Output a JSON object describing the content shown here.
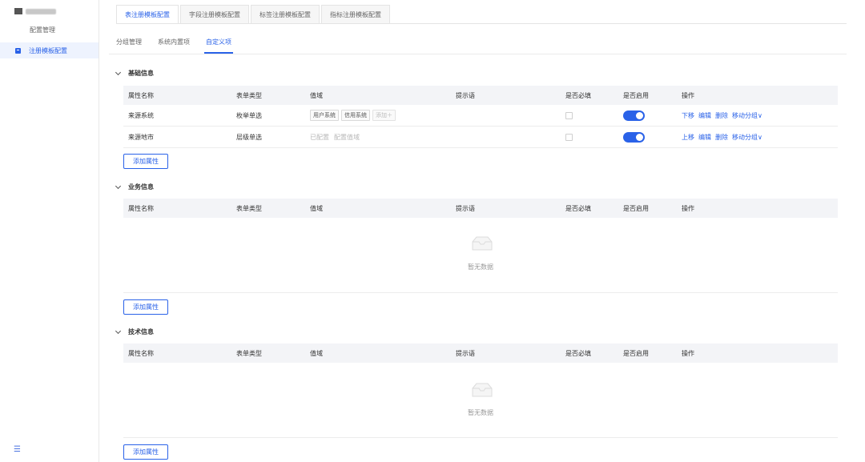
{
  "sidebar": {
    "title": "配置管理",
    "active_item": "注册模板配置"
  },
  "top_tabs": [
    "表注册模板配置",
    "字段注册模板配置",
    "标签注册模板配置",
    "指标注册模板配置"
  ],
  "sub_tabs": [
    "分组管理",
    "系统内置项",
    "自定义项"
  ],
  "columns": [
    "属性名称",
    "表单类型",
    "值域",
    "提示语",
    "是否必填",
    "是否启用",
    "操作"
  ],
  "sections": [
    {
      "title": "基础信息",
      "rows": [
        {
          "name": "来源系统",
          "type": "枚举单选",
          "domain_chips": [
            "用户系统",
            "信用系统"
          ],
          "domain_add": "添加＋",
          "ops": [
            "下移",
            "编辑",
            "删除",
            "移动分组"
          ]
        },
        {
          "name": "来源地市",
          "type": "层级单选",
          "domain_configured": "已配置",
          "domain_config_link": "配置值域",
          "ops": [
            "上移",
            "编辑",
            "删除",
            "移动分组"
          ]
        }
      ],
      "add_label": "添加属性"
    },
    {
      "title": "业务信息",
      "empty_text": "暂无数据",
      "add_label": "添加属性"
    },
    {
      "title": "技术信息",
      "empty_text": "暂无数据",
      "add_label": "添加属性"
    }
  ],
  "colors": {
    "accent": "#2a62e8",
    "header_bg": "#f3f4f7",
    "active_bg": "#eef3fe"
  }
}
